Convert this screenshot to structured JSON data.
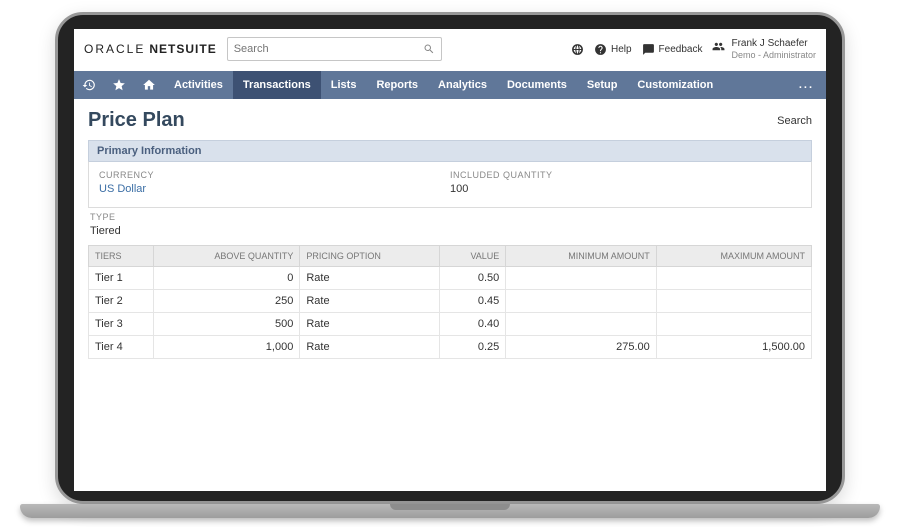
{
  "brand": {
    "oracle": "ORACLE",
    "netsuite": "NETSUITE"
  },
  "search": {
    "placeholder": "Search"
  },
  "header_links": {
    "help": "Help",
    "feedback": "Feedback"
  },
  "user": {
    "name": "Frank J Schaefer",
    "role": "Demo - Administrator"
  },
  "nav": {
    "items": [
      "Activities",
      "Transactions",
      "Lists",
      "Reports",
      "Analytics",
      "Documents",
      "Setup",
      "Customization"
    ],
    "active_index": 1,
    "more": "..."
  },
  "page": {
    "title": "Price Plan",
    "search_link": "Search",
    "primary_section_label": "Primary Information",
    "fields": {
      "currency_label": "CURRENCY",
      "currency_value": "US Dollar",
      "included_qty_label": "INCLUDED QUANTITY",
      "included_qty_value": "100",
      "type_label": "TYPE",
      "type_value": "Tiered"
    },
    "table": {
      "headers": {
        "tiers": "TIERS",
        "above_quantity": "ABOVE QUANTITY",
        "pricing_option": "PRICING OPTION",
        "value": "VALUE",
        "minimum_amount": "MINIMUM AMOUNT",
        "maximum_amount": "MAXIMUM AMOUNT"
      },
      "rows": [
        {
          "tier": "Tier 1",
          "above_quantity": "0",
          "pricing_option": "Rate",
          "value": "0.50",
          "minimum_amount": "",
          "maximum_amount": ""
        },
        {
          "tier": "Tier 2",
          "above_quantity": "250",
          "pricing_option": "Rate",
          "value": "0.45",
          "minimum_amount": "",
          "maximum_amount": ""
        },
        {
          "tier": "Tier 3",
          "above_quantity": "500",
          "pricing_option": "Rate",
          "value": "0.40",
          "minimum_amount": "",
          "maximum_amount": ""
        },
        {
          "tier": "Tier 4",
          "above_quantity": "1,000",
          "pricing_option": "Rate",
          "value": "0.25",
          "minimum_amount": "275.00",
          "maximum_amount": "1,500.00"
        }
      ]
    }
  }
}
